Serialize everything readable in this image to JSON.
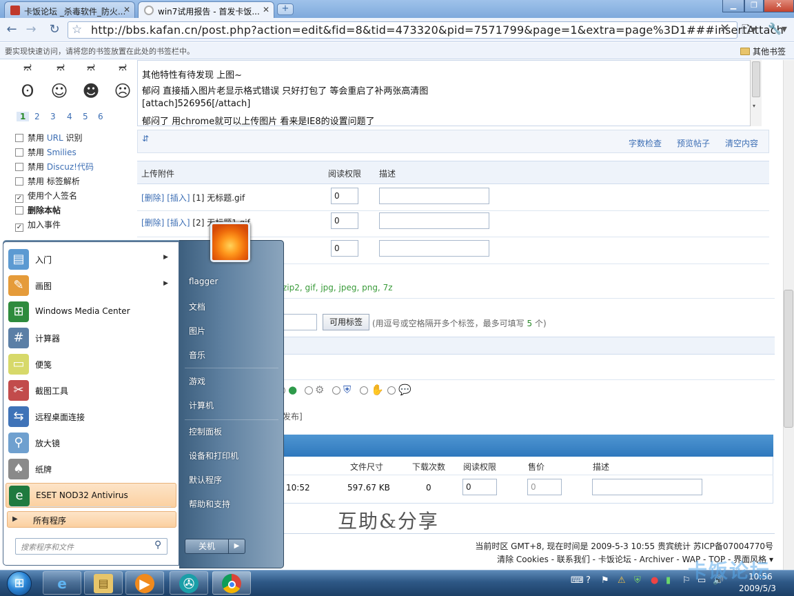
{
  "browser": {
    "tabs": [
      {
        "title": "卡饭论坛 _杀毒软件_防火...",
        "active": false
      },
      {
        "title": "win7试用报告 - 首发卡饭...",
        "active": true
      }
    ],
    "url": "http://bbs.kafan.cn/post.php?action=edit&fid=8&tid=473320&pid=7571799&page=1&extra=page%3D1###insertAttach",
    "bookmark_hint": "要实现快速访问，请将您的书签放置在此处的书签栏中。",
    "other_bookmarks": "其他书签"
  },
  "sidebar": {
    "pages": [
      "1",
      "2",
      "3",
      "4",
      "5",
      "6"
    ],
    "options": [
      {
        "prefix": "禁用 ",
        "link": "URL",
        "suffix": " 识别",
        "checked": false
      },
      {
        "prefix": "禁用 ",
        "link": "Smilies",
        "suffix": "",
        "checked": false
      },
      {
        "prefix": "禁用 ",
        "link": "Discuz!代码",
        "suffix": "",
        "checked": false
      },
      {
        "prefix": "禁用 ",
        "link": "",
        "suffix": "标签解析",
        "checked": false
      },
      {
        "prefix": "",
        "link": "",
        "suffix": "使用个人签名",
        "checked": true
      },
      {
        "prefix": "",
        "link": "",
        "suffix": "删除本帖",
        "checked": false
      },
      {
        "prefix": "",
        "link": "",
        "suffix": "加入事件",
        "checked": true
      }
    ]
  },
  "editor": {
    "lines": [
      "其他特性有待发现 上图~",
      "郁闷  直接插入图片老显示格式错误  只好打包了 等会重启了补两张高清图",
      "[attach]526956[/attach]",
      "郁闷了  用chrome就可以上传图片 看来是IE8的设置问题了"
    ],
    "toolbar": {
      "word_check": "字数检查",
      "preview": "预览帖子",
      "clear": "清空内容"
    }
  },
  "attachments": {
    "headers": {
      "upload": "上传附件",
      "read_perm": "阅读权限",
      "desc": "描述"
    },
    "rows": [
      {
        "delete": "[删除]",
        "insert": "[插入]",
        "name": "[1] 无标题.gif",
        "perm": "0"
      },
      {
        "delete": "[删除]",
        "insert": "[插入]",
        "name": "[2] 无标题1.gif",
        "perm": "0"
      },
      {
        "delete": "",
        "insert": "",
        "name": "",
        "perm": "0"
      }
    ],
    "allowed_ext": "zip2, gif, jpg, jpeg, png, 7z"
  },
  "tags": {
    "button": "可用标签",
    "hint_before": "(用逗号或空格隔开多个标签，最多可填写 ",
    "max": "5",
    "hint_after": " 个)"
  },
  "publish_tail": "发布]",
  "files": {
    "headers": {
      "size": "文件尺寸",
      "downloads": "下载次数",
      "perm": "阅读权限",
      "price": "售价",
      "desc": "描述"
    },
    "row": {
      "time": "10:52",
      "size": "597.67 KB",
      "downloads": "0",
      "perm": "0",
      "price": "0"
    }
  },
  "slogan": "互助&分享",
  "footer": {
    "line1": "当前时区 GMT+8, 现在时间是 2009-5-3 10:55 贵宾统计 苏ICP备07004770号",
    "line2": "清除 Cookies - 联系我们 - 卡饭论坛 - Archiver - WAP - TOP - 界面风格 ▾"
  },
  "start_menu": {
    "programs": [
      {
        "label": "入门",
        "icon": "getting-started-icon",
        "color": "#5c9ad2",
        "submenu": true,
        "highlight": false
      },
      {
        "label": "画图",
        "icon": "paint-icon",
        "color": "#e59b3a",
        "submenu": true,
        "highlight": false
      },
      {
        "label": "Windows Media Center",
        "icon": "media-center-icon",
        "color": "#2e8b3d",
        "submenu": false,
        "highlight": false
      },
      {
        "label": "计算器",
        "icon": "calculator-icon",
        "color": "#5b7fa6",
        "submenu": false,
        "highlight": false
      },
      {
        "label": "便笺",
        "icon": "sticky-notes-icon",
        "color": "#d7d96a",
        "submenu": false,
        "highlight": false
      },
      {
        "label": "截图工具",
        "icon": "snipping-tool-icon",
        "color": "#c24b4b",
        "submenu": false,
        "highlight": false
      },
      {
        "label": "远程桌面连接",
        "icon": "remote-desktop-icon",
        "color": "#3f73b8",
        "submenu": false,
        "highlight": false
      },
      {
        "label": "放大镜",
        "icon": "magnifier-icon",
        "color": "#6fa0cf",
        "submenu": false,
        "highlight": false
      },
      {
        "label": "纸牌",
        "icon": "solitaire-icon",
        "color": "#8a8a8a",
        "submenu": false,
        "highlight": false
      },
      {
        "label": "ESET NOD32 Antivirus",
        "icon": "eset-icon",
        "color": "#1f7a3f",
        "submenu": false,
        "highlight": true
      }
    ],
    "all_programs": "所有程序",
    "search_placeholder": "搜索程序和文件",
    "places": [
      {
        "label": "flagger"
      },
      {
        "label": "文档"
      },
      {
        "label": "图片"
      },
      {
        "label": "音乐"
      },
      {
        "label": "游戏"
      },
      {
        "label": "计算机"
      },
      {
        "label": "控制面板"
      },
      {
        "label": "设备和打印机"
      },
      {
        "label": "默认程序"
      },
      {
        "label": "帮助和支持"
      }
    ],
    "shutdown": "关机"
  },
  "taskbar": {
    "time": "10:56",
    "date": "2009/5/3"
  },
  "watermark": "卡饭论坛"
}
